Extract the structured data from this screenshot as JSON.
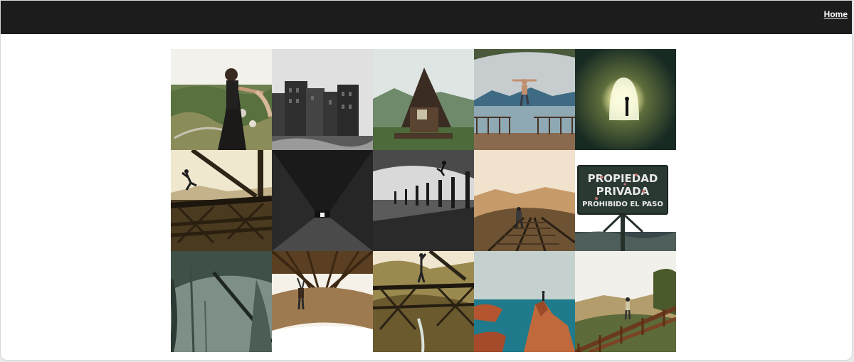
{
  "nav": {
    "home_label": "Home"
  },
  "gallery": {
    "tiles": [
      {
        "name": "photo-man-cliff-overlook",
        "theme": "mountain town, man standing on rock ledge"
      },
      {
        "name": "photo-concrete-buildings",
        "theme": "black and white brutalist apartment blocks"
      },
      {
        "name": "photo-wooden-cabin",
        "theme": "A-frame wooden cabin in the mountains"
      },
      {
        "name": "photo-jump-from-pier",
        "theme": "person jumping off wooden pier above lake"
      },
      {
        "name": "photo-tunnel-light",
        "theme": "silhouette at end of glowing tunnel"
      },
      {
        "name": "photo-leap-on-bridge",
        "theme": "person leaping on steel bridge at sunset"
      },
      {
        "name": "photo-dark-tunnel",
        "theme": "dark brick tunnel with light at the end"
      },
      {
        "name": "photo-jump-over-posts",
        "theme": "black and white jump above posts in water"
      },
      {
        "name": "photo-walk-on-rails",
        "theme": "person walking on railway tracks in haze"
      },
      {
        "name": "photo-private-property-sign",
        "theme": "sign reading private property"
      },
      {
        "name": "photo-misty-forest",
        "theme": "misty forest with fallen trunk"
      },
      {
        "name": "photo-hanging-from-bridge",
        "theme": "person hanging under bridge, mirrored"
      },
      {
        "name": "photo-standing-on-truss",
        "theme": "man standing on bridge truss over gorge"
      },
      {
        "name": "photo-sea-cliffs",
        "theme": "turquoise sea and red rock cliffs"
      },
      {
        "name": "photo-bridge-walk-hills",
        "theme": "person on rusty bridge among hills"
      }
    ],
    "sign": {
      "line1": "PROPIEDAD",
      "line2": "PRIVADA",
      "line3": "PROHIBIDO EL PASO"
    }
  },
  "colors": {
    "topbar": "#1c1c1c",
    "background": "#ffffff"
  }
}
